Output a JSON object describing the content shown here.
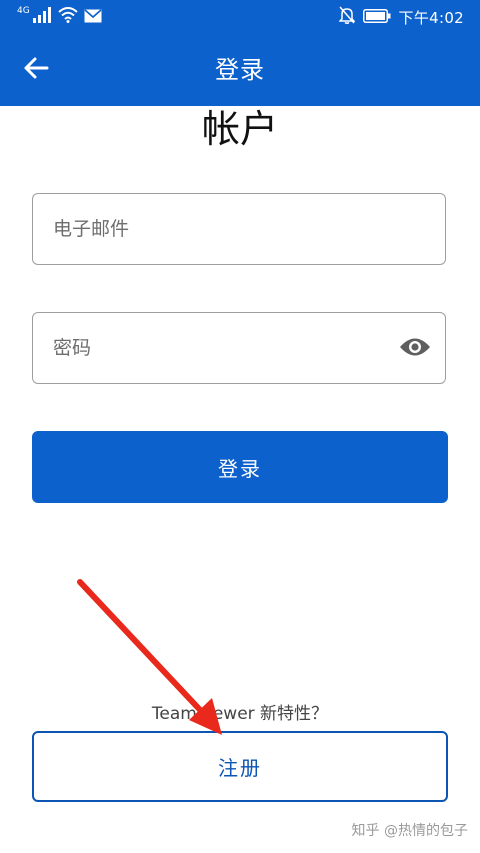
{
  "status_bar": {
    "network": "4G",
    "time": "下午4:02"
  },
  "header": {
    "title": "登录",
    "back_icon": "arrow-left-icon"
  },
  "page": {
    "title": "帐户"
  },
  "form": {
    "email_placeholder": "电子邮件",
    "password_placeholder": "密码",
    "visibility_icon": "eye-icon",
    "login_label": "登录"
  },
  "footer": {
    "whats_new": "TeamViewer 新特性？",
    "register_label": "注册"
  },
  "watermark": "知乎 @热情的包子",
  "colors": {
    "primary": "#0c61cc",
    "annotation_arrow": "#e8291c"
  }
}
